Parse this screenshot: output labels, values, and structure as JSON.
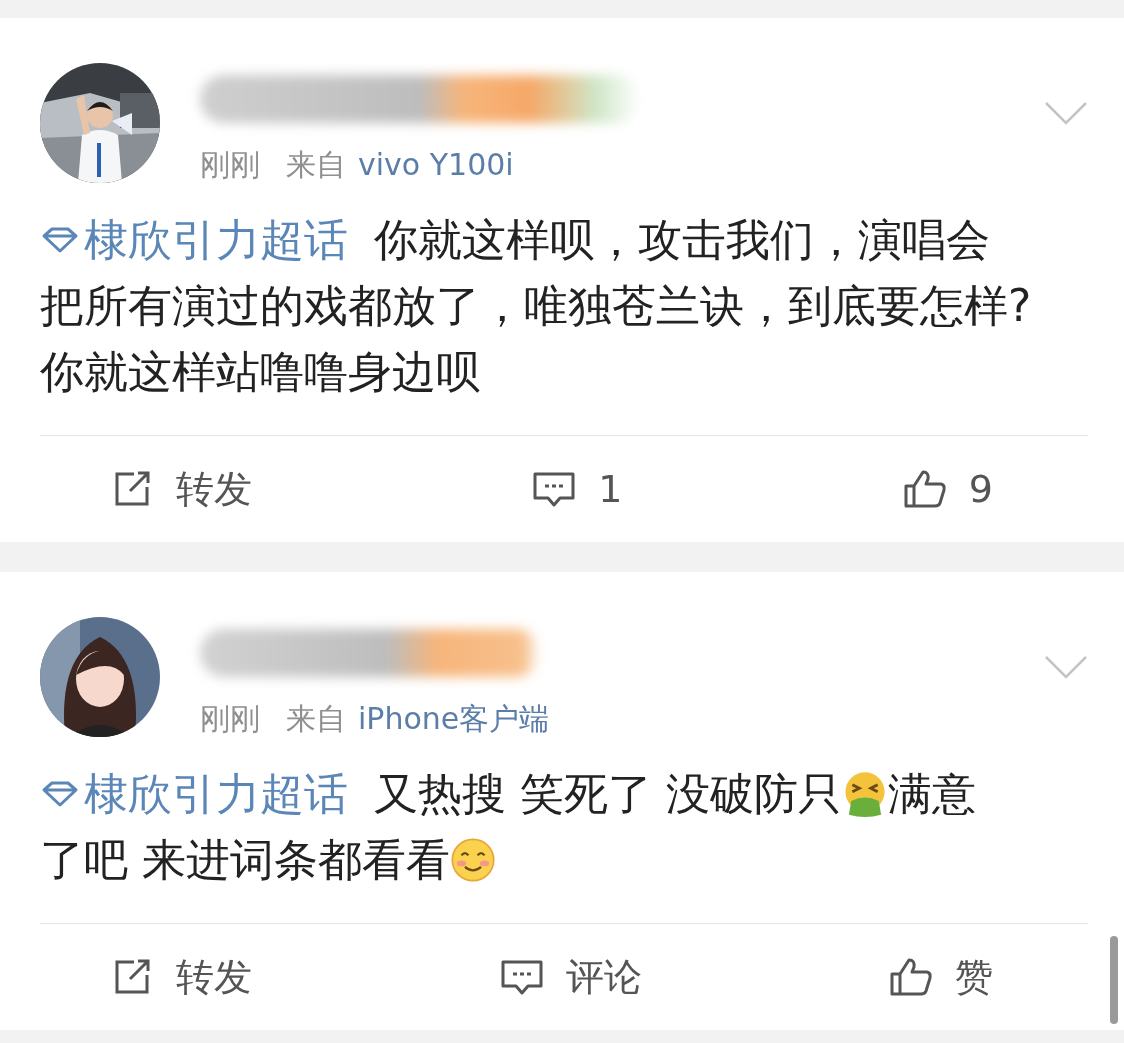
{
  "posts": [
    {
      "avatar": {
        "kind": "picture"
      },
      "time": "刚刚",
      "source_prefix": "来自",
      "source": "vivo Y100i",
      "lines": [
        [
          {
            "kind": "topic",
            "text": "棣欣引力超话"
          },
          {
            "kind": "text",
            "text": "你就这样呗，攻击我们，演唱会"
          }
        ],
        [
          {
            "kind": "text",
            "text": "把所有演过的戏都放了，唯独苍兰诀，到底要怎样?"
          }
        ],
        [
          {
            "kind": "text",
            "text": "你就这样站噜噜身边呗"
          }
        ]
      ],
      "actions": [
        {
          "kind": "repost",
          "label": "转发"
        },
        {
          "kind": "comment",
          "label": "1"
        },
        {
          "kind": "like",
          "label": "9"
        }
      ]
    },
    {
      "avatar": {
        "kind": "cartoon"
      },
      "time": "刚刚",
      "source_prefix": "来自",
      "source": "iPhone客户端",
      "lines": [
        [
          {
            "kind": "topic",
            "text": "棣欣引力超话"
          },
          {
            "kind": "text",
            "text": "又热搜 笑死了 没破防只"
          },
          {
            "kind": "vomit"
          },
          {
            "kind": "text",
            "text": "满意"
          }
        ],
        [
          {
            "kind": "text",
            "text": "了吧 来进词条都看看"
          },
          {
            "kind": "smile"
          }
        ]
      ],
      "actions": [
        {
          "kind": "repost",
          "label": "转发"
        },
        {
          "kind": "comment",
          "label": "评论"
        },
        {
          "kind": "like",
          "label": "赞"
        }
      ]
    }
  ]
}
